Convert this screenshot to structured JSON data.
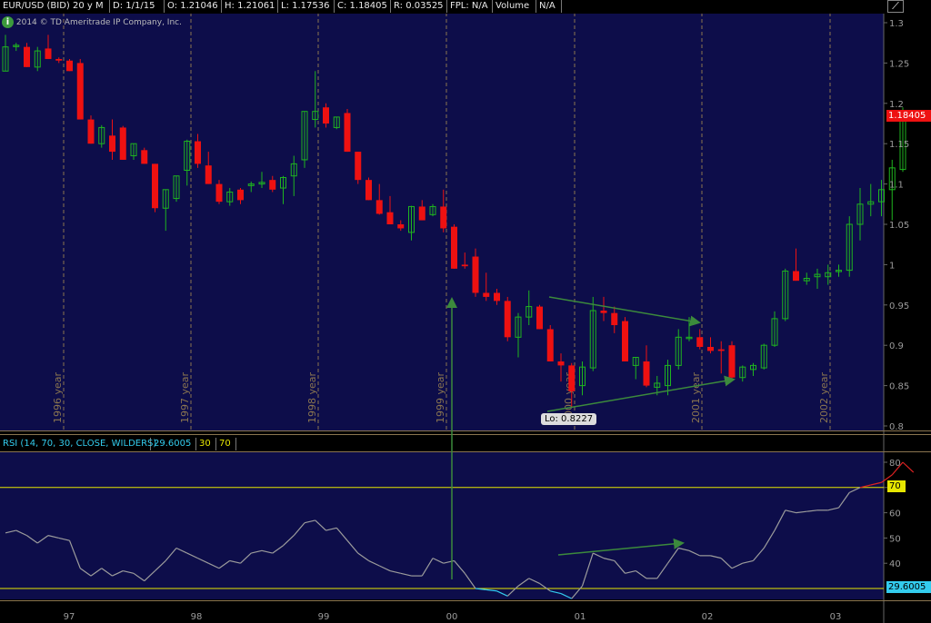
{
  "toolbar": {
    "symbol": "EUR/USD (BID) 20 y M",
    "date": "D: 1/1/15",
    "open": "O: 1.21046",
    "high": "H: 1.21061",
    "low": "L: 1.17536",
    "close": "C: 1.18405",
    "range": "R: 0.03525",
    "fpl": "FPL: N/A",
    "volume_label": "Volume",
    "volume_value": "N/A"
  },
  "copyright": "2014 © TD Ameritrade IP Company, Inc.",
  "price_badge": "1.18405",
  "lo_label": "Lo: 0.8227",
  "rsi_header": {
    "label": "RSI (14, 70, 30, CLOSE, WILDERS)",
    "value": "29.6005",
    "p1": "30",
    "p2": "70"
  },
  "rsi_badge_70": "70",
  "rsi_badge_value": "29.6005",
  "colors": {
    "background": "#0d0d4a",
    "up": "#1fb51f",
    "down": "#ee1111",
    "rsi_line": "#9c9c9c",
    "rsi_oversold": "#33ccee",
    "rsi_overbought": "#dd2222",
    "level_line": "#e6e600",
    "annotation": "#3c8a3c",
    "year_line": "#8a7550"
  },
  "chart_data": [
    {
      "type": "candlestick",
      "title": "EUR/USD (BID) 20 y M",
      "y_ticks": [
        "0.8",
        "0.85",
        "0.9",
        "0.95",
        "1",
        "1.05",
        "1.1",
        "1.15",
        "1.2",
        "1.25",
        "1.3"
      ],
      "ylim": [
        0.8,
        1.3
      ],
      "year_markers": [
        "1996 year",
        "1997 year",
        "1998 year",
        "1999 year",
        "2000 year",
        "2001 year",
        "2002 year"
      ],
      "x_ticks": [
        "97",
        "98",
        "99",
        "00",
        "01",
        "02",
        "03"
      ],
      "candles": [
        {
          "o": 1.24,
          "h": 1.285,
          "l": 1.24,
          "c": 1.27
        },
        {
          "o": 1.272,
          "h": 1.275,
          "l": 1.265,
          "c": 1.272
        },
        {
          "o": 1.27,
          "h": 1.275,
          "l": 1.245,
          "c": 1.245
        },
        {
          "o": 1.245,
          "h": 1.27,
          "l": 1.24,
          "c": 1.265
        },
        {
          "o": 1.268,
          "h": 1.285,
          "l": 1.255,
          "c": 1.255
        },
        {
          "o": 1.255,
          "h": 1.257,
          "l": 1.25,
          "c": 1.253
        },
        {
          "o": 1.253,
          "h": 1.255,
          "l": 1.24,
          "c": 1.24
        },
        {
          "o": 1.25,
          "h": 1.255,
          "l": 1.18,
          "c": 1.18
        },
        {
          "o": 1.18,
          "h": 1.185,
          "l": 1.15,
          "c": 1.15
        },
        {
          "o": 1.15,
          "h": 1.173,
          "l": 1.145,
          "c": 1.17
        },
        {
          "o": 1.16,
          "h": 1.18,
          "l": 1.13,
          "c": 1.14
        },
        {
          "o": 1.17,
          "h": 1.172,
          "l": 1.13,
          "c": 1.13
        },
        {
          "o": 1.135,
          "h": 1.15,
          "l": 1.13,
          "c": 1.15
        },
        {
          "o": 1.142,
          "h": 1.145,
          "l": 1.125,
          "c": 1.125
        },
        {
          "o": 1.125,
          "h": 1.125,
          "l": 1.065,
          "c": 1.07
        },
        {
          "o": 1.07,
          "h": 1.093,
          "l": 1.042,
          "c": 1.093
        },
        {
          "o": 1.082,
          "h": 1.11,
          "l": 1.078,
          "c": 1.11
        },
        {
          "o": 1.117,
          "h": 1.155,
          "l": 1.098,
          "c": 1.153
        },
        {
          "o": 1.153,
          "h": 1.162,
          "l": 1.12,
          "c": 1.125
        },
        {
          "o": 1.123,
          "h": 1.14,
          "l": 1.1,
          "c": 1.1
        },
        {
          "o": 1.1,
          "h": 1.105,
          "l": 1.075,
          "c": 1.078
        },
        {
          "o": 1.078,
          "h": 1.095,
          "l": 1.073,
          "c": 1.09
        },
        {
          "o": 1.093,
          "h": 1.095,
          "l": 1.075,
          "c": 1.08
        },
        {
          "o": 1.098,
          "h": 1.103,
          "l": 1.09,
          "c": 1.1
        },
        {
          "o": 1.1,
          "h": 1.115,
          "l": 1.095,
          "c": 1.102
        },
        {
          "o": 1.105,
          "h": 1.11,
          "l": 1.09,
          "c": 1.093
        },
        {
          "o": 1.095,
          "h": 1.11,
          "l": 1.075,
          "c": 1.108
        },
        {
          "o": 1.11,
          "h": 1.135,
          "l": 1.085,
          "c": 1.125
        },
        {
          "o": 1.13,
          "h": 1.19,
          "l": 1.12,
          "c": 1.19
        },
        {
          "o": 1.18,
          "h": 1.24,
          "l": 1.17,
          "c": 1.19
        },
        {
          "o": 1.195,
          "h": 1.2,
          "l": 1.17,
          "c": 1.175
        },
        {
          "o": 1.17,
          "h": 1.183,
          "l": 1.168,
          "c": 1.183
        },
        {
          "o": 1.188,
          "h": 1.193,
          "l": 1.14,
          "c": 1.14
        },
        {
          "o": 1.14,
          "h": 1.14,
          "l": 1.1,
          "c": 1.105
        },
        {
          "o": 1.105,
          "h": 1.108,
          "l": 1.08,
          "c": 1.08
        },
        {
          "o": 1.08,
          "h": 1.1,
          "l": 1.062,
          "c": 1.063
        },
        {
          "o": 1.065,
          "h": 1.085,
          "l": 1.05,
          "c": 1.05
        },
        {
          "o": 1.05,
          "h": 1.055,
          "l": 1.042,
          "c": 1.045
        },
        {
          "o": 1.04,
          "h": 1.073,
          "l": 1.03,
          "c": 1.072
        },
        {
          "o": 1.072,
          "h": 1.08,
          "l": 1.055,
          "c": 1.055
        },
        {
          "o": 1.062,
          "h": 1.075,
          "l": 1.06,
          "c": 1.072
        },
        {
          "o": 1.072,
          "h": 1.093,
          "l": 1.04,
          "c": 1.045
        },
        {
          "o": 1.047,
          "h": 1.05,
          "l": 0.995,
          "c": 0.995
        },
        {
          "o": 1.0,
          "h": 1.015,
          "l": 0.995,
          "c": 0.998
        },
        {
          "o": 1.01,
          "h": 1.02,
          "l": 0.96,
          "c": 0.965
        },
        {
          "o": 0.965,
          "h": 0.99,
          "l": 0.955,
          "c": 0.96
        },
        {
          "o": 0.965,
          "h": 0.97,
          "l": 0.95,
          "c": 0.955
        },
        {
          "o": 0.955,
          "h": 0.96,
          "l": 0.905,
          "c": 0.91
        },
        {
          "o": 0.91,
          "h": 0.94,
          "l": 0.885,
          "c": 0.935
        },
        {
          "o": 0.935,
          "h": 0.968,
          "l": 0.925,
          "c": 0.948
        },
        {
          "o": 0.948,
          "h": 0.95,
          "l": 0.92,
          "c": 0.92
        },
        {
          "o": 0.92,
          "h": 0.925,
          "l": 0.88,
          "c": 0.88
        },
        {
          "o": 0.88,
          "h": 0.89,
          "l": 0.855,
          "c": 0.875
        },
        {
          "o": 0.875,
          "h": 0.878,
          "l": 0.823,
          "c": 0.843
        },
        {
          "o": 0.85,
          "h": 0.88,
          "l": 0.838,
          "c": 0.873
        },
        {
          "o": 0.872,
          "h": 0.96,
          "l": 0.868,
          "c": 0.943
        },
        {
          "o": 0.943,
          "h": 0.96,
          "l": 0.93,
          "c": 0.94
        },
        {
          "o": 0.94,
          "h": 0.948,
          "l": 0.915,
          "c": 0.925
        },
        {
          "o": 0.93,
          "h": 0.935,
          "l": 0.88,
          "c": 0.88
        },
        {
          "o": 0.875,
          "h": 0.885,
          "l": 0.858,
          "c": 0.885
        },
        {
          "o": 0.88,
          "h": 0.9,
          "l": 0.848,
          "c": 0.85
        },
        {
          "o": 0.848,
          "h": 0.862,
          "l": 0.838,
          "c": 0.853
        },
        {
          "o": 0.85,
          "h": 0.882,
          "l": 0.838,
          "c": 0.875
        },
        {
          "o": 0.875,
          "h": 0.92,
          "l": 0.87,
          "c": 0.91
        },
        {
          "o": 0.91,
          "h": 0.935,
          "l": 0.905,
          "c": 0.91
        },
        {
          "o": 0.91,
          "h": 0.92,
          "l": 0.895,
          "c": 0.898
        },
        {
          "o": 0.898,
          "h": 0.91,
          "l": 0.89,
          "c": 0.893
        },
        {
          "o": 0.895,
          "h": 0.905,
          "l": 0.865,
          "c": 0.893
        },
        {
          "o": 0.9,
          "h": 0.905,
          "l": 0.858,
          "c": 0.86
        },
        {
          "o": 0.86,
          "h": 0.875,
          "l": 0.855,
          "c": 0.873
        },
        {
          "o": 0.87,
          "h": 0.878,
          "l": 0.862,
          "c": 0.875
        },
        {
          "o": 0.872,
          "h": 0.902,
          "l": 0.87,
          "c": 0.9
        },
        {
          "o": 0.9,
          "h": 0.942,
          "l": 0.898,
          "c": 0.933
        },
        {
          "o": 0.933,
          "h": 0.995,
          "l": 0.93,
          "c": 0.992
        },
        {
          "o": 0.992,
          "h": 1.02,
          "l": 0.98,
          "c": 0.98
        },
        {
          "o": 0.98,
          "h": 0.99,
          "l": 0.975,
          "c": 0.983
        },
        {
          "o": 0.985,
          "h": 0.995,
          "l": 0.97,
          "c": 0.988
        },
        {
          "o": 0.985,
          "h": 1.0,
          "l": 0.975,
          "c": 0.99
        },
        {
          "o": 0.993,
          "h": 1.0,
          "l": 0.985,
          "c": 0.993
        },
        {
          "o": 0.993,
          "h": 1.06,
          "l": 0.985,
          "c": 1.05
        },
        {
          "o": 1.05,
          "h": 1.095,
          "l": 1.03,
          "c": 1.075
        },
        {
          "o": 1.075,
          "h": 1.1,
          "l": 1.06,
          "c": 1.078
        },
        {
          "o": 1.078,
          "h": 1.105,
          "l": 1.06,
          "c": 1.093
        },
        {
          "o": 1.093,
          "h": 1.13,
          "l": 1.055,
          "c": 1.12
        },
        {
          "o": 1.118,
          "h": 1.195,
          "l": 1.115,
          "c": 1.182
        }
      ]
    },
    {
      "type": "line",
      "title": "RSI (14, 70, 30, CLOSE, WILDERS)",
      "y_ticks": [
        "40",
        "50",
        "60",
        "70",
        "80"
      ],
      "ylim": [
        22,
        86
      ],
      "levels": [
        30,
        70
      ],
      "x_ticks": [
        "97",
        "98",
        "99",
        "00",
        "01",
        "02",
        "03"
      ],
      "series": [
        {
          "values": [
            52,
            53,
            51,
            48,
            51,
            50,
            49,
            38,
            35,
            38,
            35,
            37,
            36,
            33,
            37,
            41,
            46,
            44,
            42,
            40,
            38,
            41,
            40,
            44,
            45,
            44,
            47,
            51,
            56,
            57,
            53,
            54,
            49,
            44,
            41,
            39,
            37,
            36,
            35,
            35,
            42,
            40,
            41,
            36,
            30,
            29.5,
            29,
            27,
            31,
            34,
            32,
            29,
            28,
            26,
            31,
            44,
            42,
            41,
            36,
            37,
            34,
            34,
            40,
            46,
            45,
            43,
            43,
            42,
            38,
            40,
            41,
            46,
            53,
            61,
            60,
            60.5,
            61,
            61,
            62,
            68,
            70,
            71,
            72,
            75,
            80,
            76
          ]
        }
      ]
    }
  ]
}
